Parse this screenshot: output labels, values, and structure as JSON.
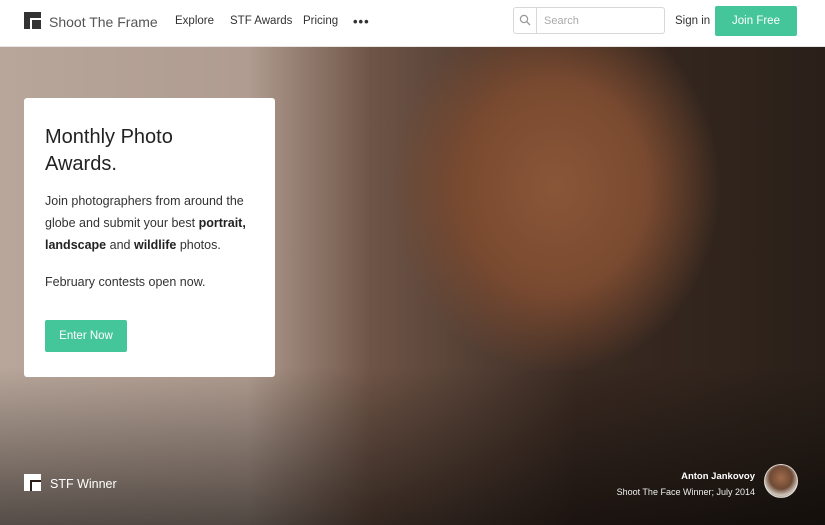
{
  "brand": {
    "name": "Shoot The Frame"
  },
  "nav": {
    "links": [
      "Explore",
      "STF Awards",
      "Pricing"
    ],
    "more": "•••",
    "search_placeholder": "Search",
    "signin": "Sign in",
    "join": "Join Free"
  },
  "promo": {
    "title": "Monthly Photo Awards.",
    "body_intro": "Join photographers from around the globe and submit your best",
    "body_bold_1": "portrait,",
    "body_bold_2": "landscape",
    "body_and": "and",
    "body_bold_3": "wildlife",
    "body_end": "photos.",
    "open_notice": "February contests open now.",
    "cta": "Enter Now"
  },
  "footer": {
    "winner_label": "STF Winner",
    "photographer": "Anton Jankovoy",
    "award": "Shoot The Face Winner; July 2014"
  },
  "colors": {
    "accent": "#45c59a"
  },
  "icons": [
    "logo-icon",
    "search-icon",
    "more-icon",
    "avatar"
  ]
}
